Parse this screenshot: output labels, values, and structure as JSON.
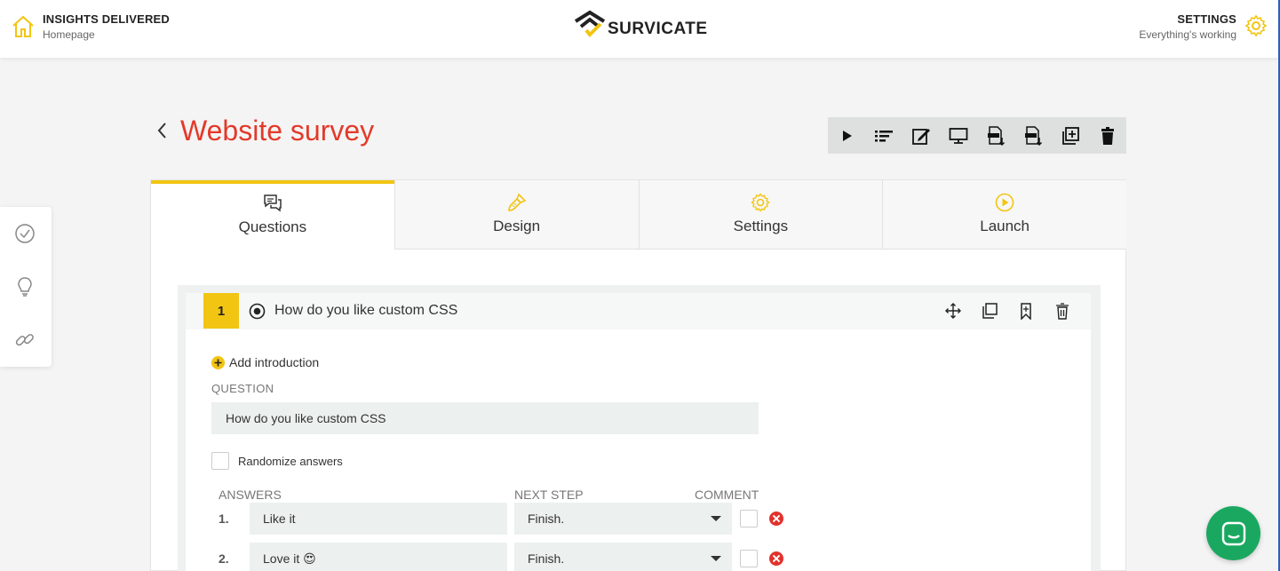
{
  "colors": {
    "accent": "#f2c512",
    "title_red": "#e33a2a",
    "chat_green": "#1aa860",
    "delete_red": "#e3312c"
  },
  "header": {
    "left_title": "INSIGHTS DELIVERED",
    "left_subtitle": "Homepage",
    "left_icon": "home-icon",
    "logo_text": "SURVICATE",
    "right_title": "SETTINGS",
    "right_subtitle": "Everything's working",
    "right_icon": "gear-icon"
  },
  "leftnav": {
    "items": [
      "check-circle-icon",
      "lightbulb-icon",
      "link-icon"
    ]
  },
  "page": {
    "title": "Website survey"
  },
  "toolbar": {
    "buttons": [
      "play-icon",
      "list-icon",
      "edit-icon",
      "monitor-icon",
      "csv-download-icon",
      "xls-download-icon",
      "duplicate-icon",
      "trash-icon"
    ]
  },
  "tabs": [
    {
      "label": "Questions",
      "icon": "chat-icon",
      "active": true
    },
    {
      "label": "Design",
      "icon": "brush-icon",
      "active": false
    },
    {
      "label": "Settings",
      "icon": "gear-icon",
      "active": false
    },
    {
      "label": "Launch",
      "icon": "play-circle-icon",
      "active": false
    }
  ],
  "question": {
    "number": "1",
    "title": "How do you like custom CSS",
    "add_intro": "Add introduction",
    "label": "QUESTION",
    "value": "How do you like custom CSS",
    "randomize": "Randomize answers",
    "col_answers": "ANSWERS",
    "col_next": "NEXT STEP",
    "col_comment": "COMMENT",
    "answers": [
      {
        "index": "1.",
        "text": "Like it",
        "next": "Finish."
      },
      {
        "index": "2.",
        "text": "Love it 😍",
        "next": "Finish."
      }
    ]
  }
}
